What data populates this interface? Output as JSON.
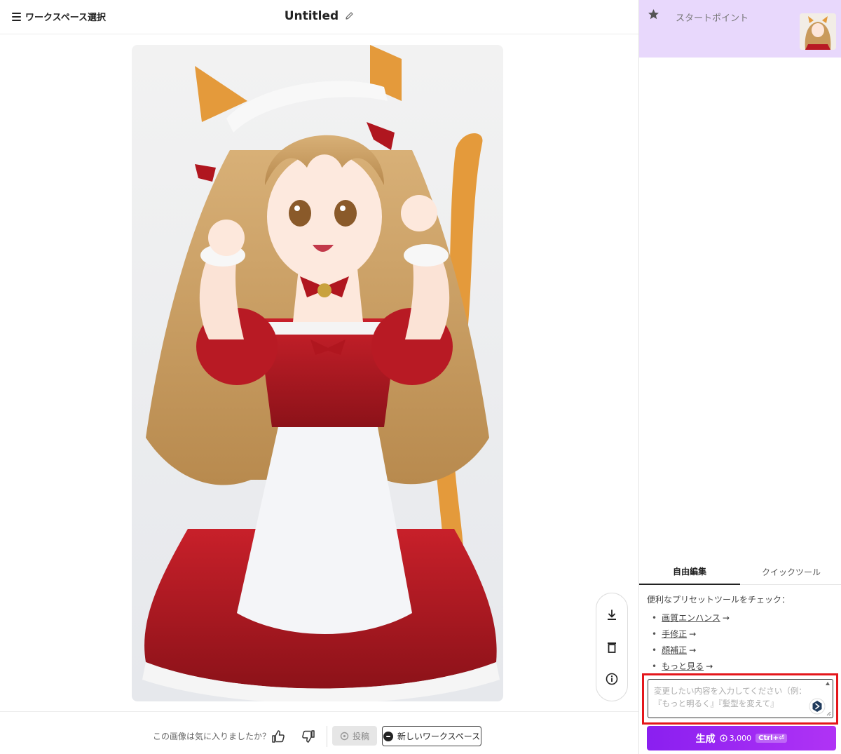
{
  "header": {
    "workspace_select": "ワークスペース選択",
    "title": "Untitled"
  },
  "canvas": {
    "image_alt": "anime cat-ear maid girl illustration"
  },
  "side_tools": [
    "download-icon",
    "trash-icon",
    "info-icon"
  ],
  "footer": {
    "feedback_question": "この画像は気に入りましたか？",
    "post_label": "投稿",
    "new_workspace_label": "新しいワークスペース"
  },
  "panel": {
    "start_point_label": "スタートポイント",
    "tabs": {
      "free_edit": "自由編集",
      "quick_tools": "クイックツール"
    },
    "presets_heading": "便利なプリセットツールをチェック：",
    "presets": [
      {
        "label": "画質エンハンス"
      },
      {
        "label": "手修正"
      },
      {
        "label": "顔補正"
      },
      {
        "label": "もっと見る"
      }
    ],
    "prompt_placeholder": "変更したい内容を入力してください（例：『もっと明るく』『髪型を変えて』",
    "generate_label": "生成",
    "generate_cost": "3,000",
    "generate_shortcut": "Ctrl+⏎"
  },
  "colors": {
    "accent_purple": "#9b2cf2",
    "start_card_bg": "#e8d8fc",
    "highlight_red": "#e4161b"
  }
}
